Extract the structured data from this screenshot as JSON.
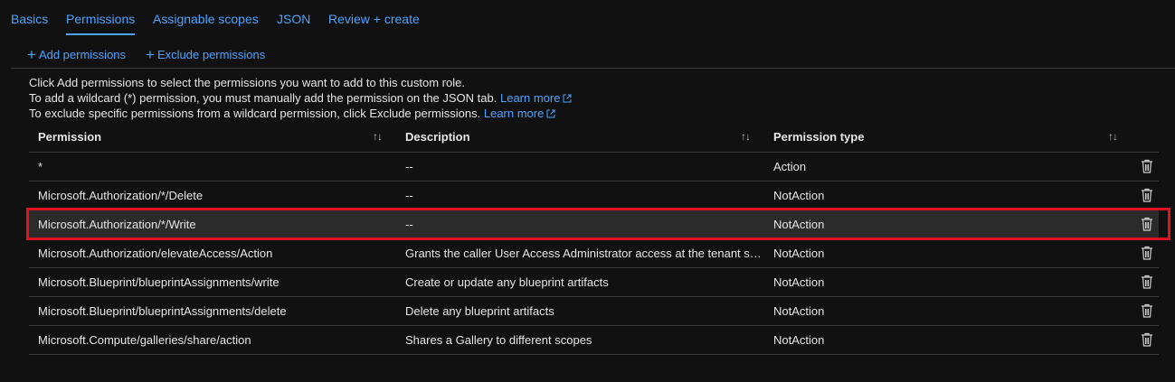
{
  "tabs": [
    {
      "label": "Basics"
    },
    {
      "label": "Permissions",
      "active": true
    },
    {
      "label": "Assignable scopes"
    },
    {
      "label": "JSON"
    },
    {
      "label": "Review + create"
    }
  ],
  "commands": {
    "add_label": "Add permissions",
    "exclude_label": "Exclude permissions"
  },
  "info": {
    "line1": "Click Add permissions to select the permissions you want to add to this custom role.",
    "line2": "To add a wildcard (*) permission, you must manually add the permission on the JSON tab.",
    "line2_link": "Learn more",
    "line3": "To exclude specific permissions from a wildcard permission, click Exclude permissions.",
    "line3_link": "Learn more"
  },
  "table": {
    "columns": [
      "Permission",
      "Description",
      "Permission type"
    ],
    "rows": [
      {
        "permission": "*",
        "description": "--",
        "type": "Action"
      },
      {
        "permission": "Microsoft.Authorization/*/Delete",
        "description": "--",
        "type": "NotAction"
      },
      {
        "permission": "Microsoft.Authorization/*/Write",
        "description": "--",
        "type": "NotAction",
        "selected": true
      },
      {
        "permission": "Microsoft.Authorization/elevateAccess/Action",
        "description": "Grants the caller User Access Administrator access at the tenant sco...",
        "type": "NotAction"
      },
      {
        "permission": "Microsoft.Blueprint/blueprintAssignments/write",
        "description": "Create or update any blueprint artifacts",
        "type": "NotAction"
      },
      {
        "permission": "Microsoft.Blueprint/blueprintAssignments/delete",
        "description": "Delete any blueprint artifacts",
        "type": "NotAction"
      },
      {
        "permission": "Microsoft.Compute/galleries/share/action",
        "description": "Shares a Gallery to different scopes",
        "type": "NotAction"
      }
    ]
  },
  "colors": {
    "accent": "#4da3ff",
    "highlight": "#e0141e",
    "background": "#111111"
  },
  "icons": {
    "add": "plus-icon",
    "exclude": "plus-icon",
    "external": "external-link-icon",
    "sort": "sort-icon",
    "delete": "trash-icon"
  }
}
